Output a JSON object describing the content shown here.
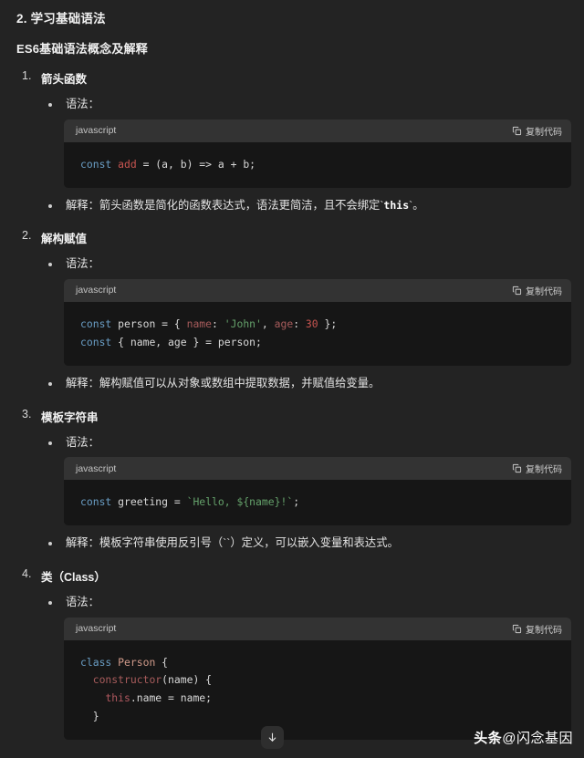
{
  "document": {
    "section_title": "2. 学习基础语法",
    "subsection_title": "ES6基础语法概念及解释"
  },
  "labels": {
    "syntax": "语法：",
    "code_lang": "javascript",
    "copy_label": "复制代码",
    "copy_icon": "copy-icon",
    "scroll_icon": "arrow-down-icon"
  },
  "topics": [
    {
      "num": "1.",
      "title": "箭头函数",
      "syntax_label": "语法：",
      "lang": "javascript",
      "copy_label": "复制代码",
      "code_tokens": [
        [
          [
            "kw",
            "const"
          ],
          [
            "plain",
            " "
          ],
          [
            "fn",
            "add"
          ],
          [
            "plain",
            " = (a, b) => a + b;"
          ]
        ]
      ],
      "explain_prefix": "解释：箭头函数是简化的函数表达式，语法更简洁，且不会绑定`",
      "explain_code": "this",
      "explain_suffix": "`。"
    },
    {
      "num": "2.",
      "title": "解构赋值",
      "syntax_label": "语法：",
      "lang": "javascript",
      "copy_label": "复制代码",
      "code_tokens": [
        [
          [
            "kw",
            "const"
          ],
          [
            "plain",
            " person = { "
          ],
          [
            "prop",
            "name"
          ],
          [
            "plain",
            ": "
          ],
          [
            "str",
            "'John'"
          ],
          [
            "plain",
            ", "
          ],
          [
            "prop",
            "age"
          ],
          [
            "plain",
            ": "
          ],
          [
            "num",
            "30"
          ],
          [
            "plain",
            " };"
          ]
        ],
        [
          [
            "kw",
            "const"
          ],
          [
            "plain",
            " { name, age } = person;"
          ]
        ]
      ],
      "explain_prefix": "解释：解构赋值可以从对象或数组中提取数据，并赋值给变量。",
      "explain_code": "",
      "explain_suffix": ""
    },
    {
      "num": "3.",
      "title": "模板字符串",
      "syntax_label": "语法：",
      "lang": "javascript",
      "copy_label": "复制代码",
      "code_tokens": [
        [
          [
            "kw",
            "const"
          ],
          [
            "plain",
            " greeting = "
          ],
          [
            "str",
            "`Hello, ${name}!`"
          ],
          [
            "plain",
            ";"
          ]
        ]
      ],
      "explain_prefix": "解释：模板字符串使用反引号（``）定义，可以嵌入变量和表达式。",
      "explain_code": "",
      "explain_suffix": ""
    },
    {
      "num": "4.",
      "title": "类（Class）",
      "syntax_label": "语法：",
      "lang": "javascript",
      "copy_label": "复制代码",
      "code_tokens": [
        [
          [
            "kw",
            "class"
          ],
          [
            "plain",
            " "
          ],
          [
            "cls",
            "Person"
          ],
          [
            "plain",
            " {"
          ]
        ],
        [
          [
            "plain",
            "  "
          ],
          [
            "prop",
            "constructor"
          ],
          [
            "plain",
            "(name) {"
          ]
        ],
        [
          [
            "plain",
            "    "
          ],
          [
            "this",
            "this"
          ],
          [
            "plain",
            ".name = name;"
          ]
        ],
        [
          [
            "plain",
            "  }"
          ]
        ]
      ],
      "explain_prefix": "",
      "explain_code": "",
      "explain_suffix": ""
    }
  ],
  "watermark": {
    "brand": "头条",
    "handle": "@闪念基因"
  },
  "colors": {
    "page_bg": "#232323",
    "code_body_bg": "#161616",
    "code_head_bg": "#333333",
    "keyword": "#6a9ec5",
    "string": "#64a06a",
    "number": "#c75450",
    "property": "#a85c5c"
  }
}
